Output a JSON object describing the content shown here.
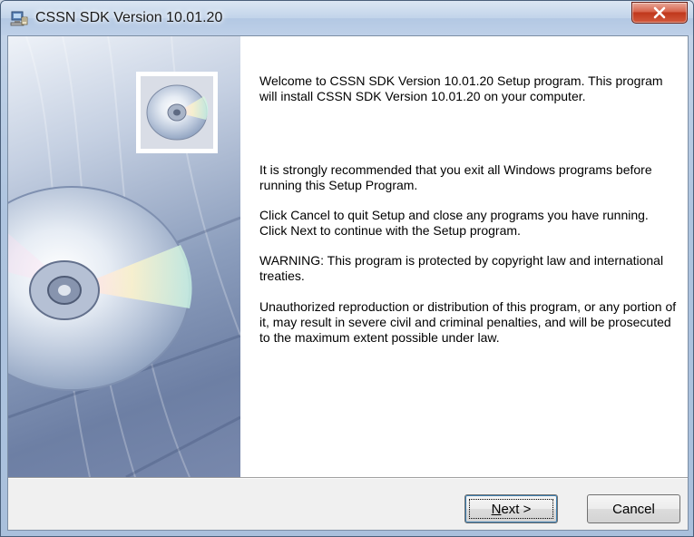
{
  "window": {
    "title": "CSSN SDK Version 10.01.20",
    "app_icon": "setup-computer-icon",
    "close_icon": "close-icon"
  },
  "banner": {
    "icon": "cd-disc-icon"
  },
  "content": {
    "paragraphs": [
      "Welcome to CSSN SDK Version 10.01.20 Setup program. This program will install CSSN SDK Version 10.01.20 on your computer.",
      "It is strongly recommended that you exit all Windows programs before running this Setup Program.",
      "Click Cancel to quit Setup and close any programs you have running.  Click Next to continue with the Setup program.",
      "WARNING: This program is protected by copyright law and international treaties.",
      "Unauthorized reproduction or distribution of this program, or any portion of it, may result in severe civil and criminal penalties, and will be prosecuted to the maximum extent possible under law."
    ]
  },
  "buttons": {
    "next_mnemonic": "N",
    "next_rest": "ext >",
    "cancel_label": "Cancel"
  },
  "colors": {
    "close_button": "#c0381c",
    "title_bar": "#bed0e8"
  }
}
